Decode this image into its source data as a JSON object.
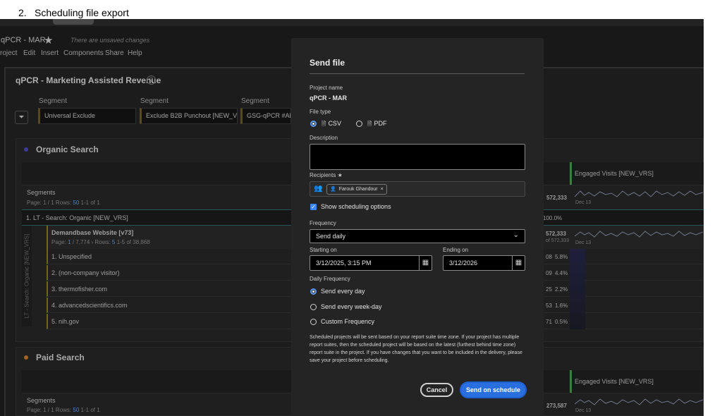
{
  "doc": {
    "number": "2.",
    "heading": "Scheduling file export"
  },
  "project": {
    "short_name": "qPCR - MAR",
    "unsaved": "There are unsaved changes",
    "menu": [
      "roject",
      "Edit",
      "Insert",
      "Components",
      "Share",
      "Help"
    ]
  },
  "panel": {
    "title": "qPCR - Marketing Assisted Revenue",
    "segments": [
      {
        "label": "Segment",
        "value": "Universal Exclude"
      },
      {
        "label": "Segment",
        "value": "Exclude B2B Punchout [NEW_VRS]"
      },
      {
        "label": "Segment",
        "value": "GSG-qPCR #All"
      }
    ]
  },
  "organic": {
    "title": "Organic Search",
    "engaged_header": "Engaged Visits [NEW_VRS]",
    "segments_label": "Segments",
    "page_prefix": "Page: 1 / 1  Rows:",
    "rows_count": "50",
    "page_suffix": "1-1 of 1",
    "total": "572,333",
    "spark_date": "Dec 13",
    "lt_row": "1.  LT - Search: Organic [NEW_VRS]",
    "lt_pct": "100.0%",
    "sub_header": "Demandbase Website [v73]",
    "sub_page_a": "Page:",
    "sub_page_b": "1",
    "sub_page_c": "/ 7,774 ›  Rows:",
    "sub_page_d": "5",
    "sub_page_e": "1-5 of 38,868",
    "sub_total": "572,333",
    "sub_of": "of 572,333",
    "vertical_label": "LT - Search: Organic [NEW_VRS]",
    "rows": [
      {
        "label": "1.  Unspecified",
        "num": "08",
        "pct": "5.8%"
      },
      {
        "label": "2.  (non-company visitor)",
        "num": "09",
        "pct": "4.4%"
      },
      {
        "label": "3.  thermofisher.com",
        "num": "25",
        "pct": "2.2%"
      },
      {
        "label": "4.  advancedscientifics.com",
        "num": "53",
        "pct": "1.6%"
      },
      {
        "label": "5.  nih.gov",
        "num": "71",
        "pct": "0.5%"
      }
    ]
  },
  "paid": {
    "title": "Paid Search",
    "engaged_header": "Engaged Visits [NEW_VRS]",
    "segments_label": "Segments",
    "page_prefix": "Page: 1 / 1  Rows:",
    "rows_count": "50",
    "page_suffix": "1-1 of 1",
    "total": "273,587",
    "spark_date": "Dec 13"
  },
  "modal": {
    "title": "Send file",
    "project_name_label": "Project name",
    "project_name": "qPCR - MAR",
    "file_type_label": "File type",
    "file_types": [
      "CSV",
      "PDF"
    ],
    "file_type_selected": "CSV",
    "description_label": "Description",
    "recipients_label": "Recipients ★",
    "recipient": "Farouk Ghandour",
    "show_scheduling": "Show scheduling options",
    "frequency_label": "Frequency",
    "frequency": "Send daily",
    "starting_label": "Starting on",
    "starting_value": "3/12/2025, 3:15 PM",
    "ending_label": "Ending on",
    "ending_value": "3/12/2026",
    "daily_label": "Daily Frequency",
    "daily_options": [
      "Send every day",
      "Send every week-day",
      "Custom Frequency"
    ],
    "daily_selected": "Send every day",
    "notice": "Scheduled projects will be sent based on your report suite time zone. If your project has multiple report suites, then the scheduled project will be based on the latest (furthest behind time zone) report suite in the project. If you have changes that you want to be included in the delivery, please save your project before scheduling.",
    "cancel": "Cancel",
    "send": "Send on schedule"
  },
  "colors": {
    "accent": "#2a6fe0",
    "background": "#1e1e1e",
    "modal": "#242424"
  }
}
